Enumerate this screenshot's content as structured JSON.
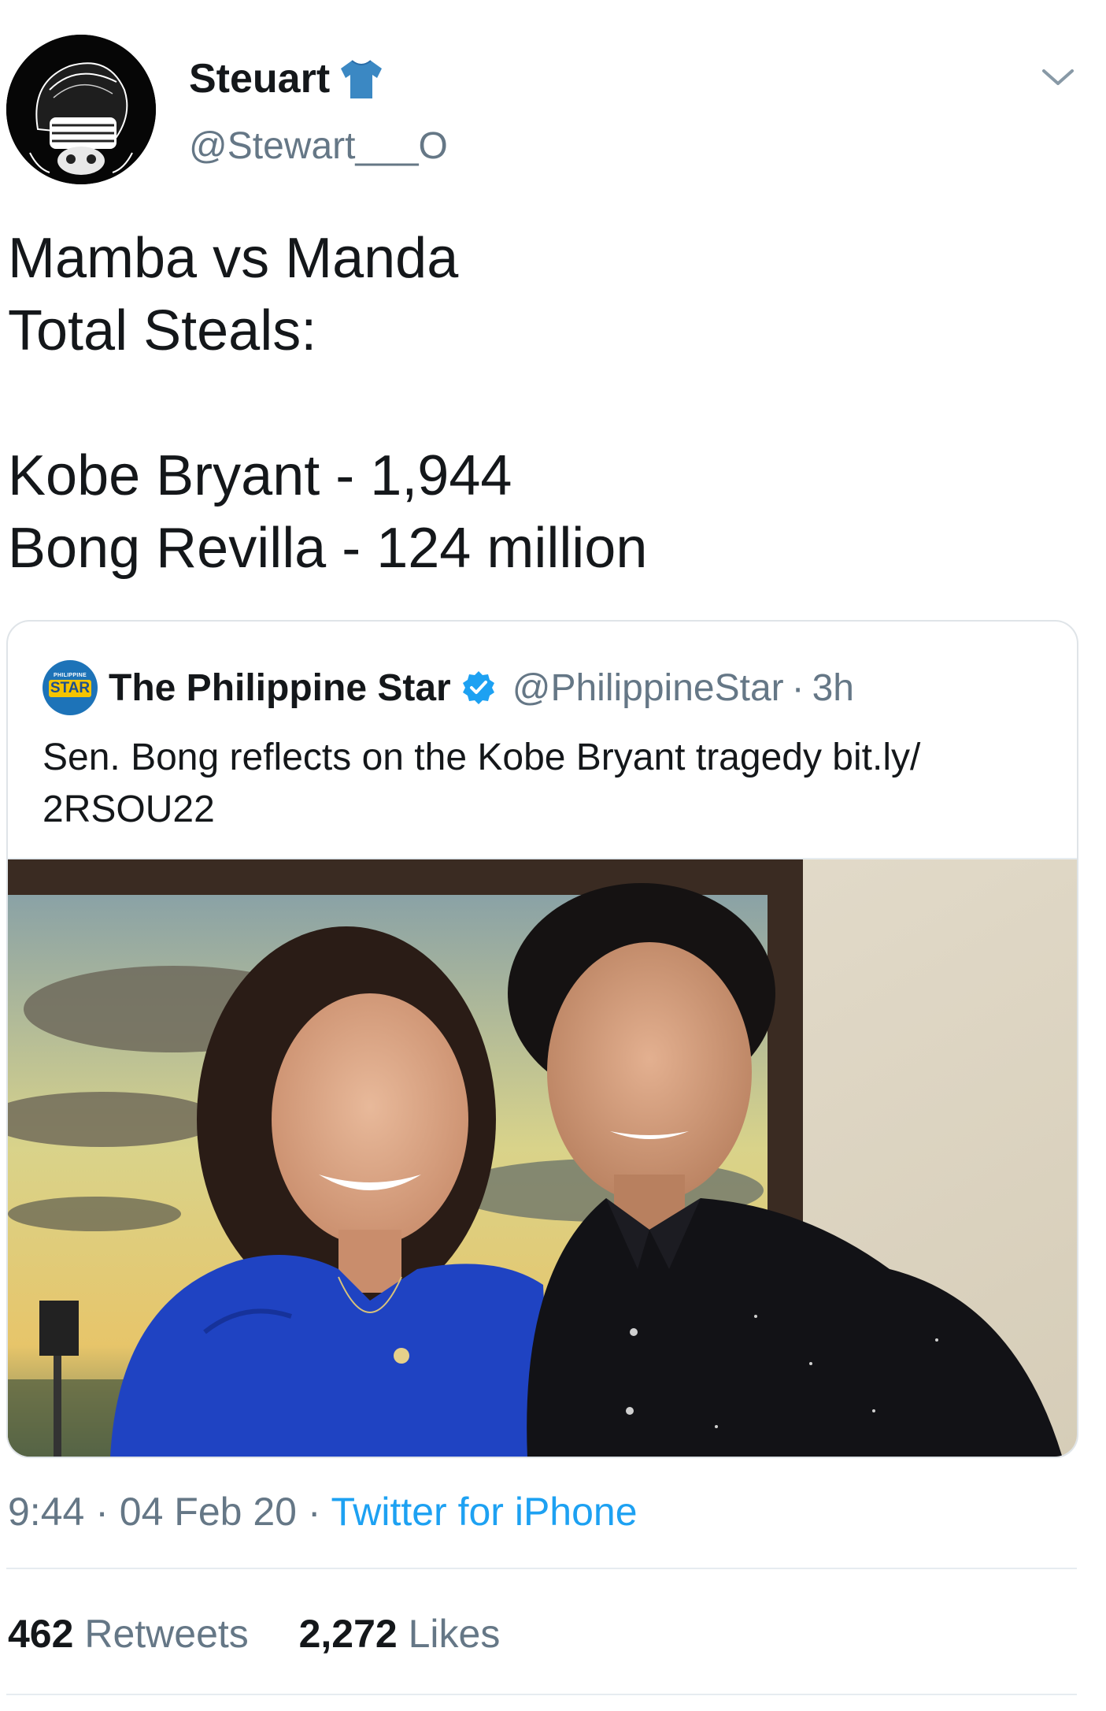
{
  "tweet": {
    "author": {
      "name": "Steuart",
      "handle": "@Stewart___O",
      "name_emoji_icon": "t-shirt-icon"
    },
    "text_lines": [
      "Mamba vs Manda",
      "Total Steals:",
      "",
      "Kobe Bryant - 1,944",
      "Bong Revilla - 124 million"
    ],
    "quoted": {
      "name": "The Philippine Star",
      "handle": "@PhilippineStar",
      "separator": "·",
      "time": "3h",
      "logo_text_top": "PHILIPPINE",
      "logo_text_main": "STAR",
      "text_line1": "Sen. Bong reflects on the Kobe Bryant tragedy bit.ly/",
      "text_line2": "2RSOU22",
      "verified_icon": "verified-badge-icon"
    },
    "meta": {
      "time": "9:44",
      "sep1": " · ",
      "date": "04 Feb 20",
      "sep2": " · ",
      "source": "Twitter for iPhone"
    },
    "stats": {
      "retweets_count": "462",
      "retweets_label": "Retweets",
      "likes_count": "2,272",
      "likes_label": "Likes"
    }
  },
  "colors": {
    "link": "#1da1f2",
    "secondary_text": "#657786",
    "primary_text": "#14171a",
    "border": "#e6ecf0"
  }
}
